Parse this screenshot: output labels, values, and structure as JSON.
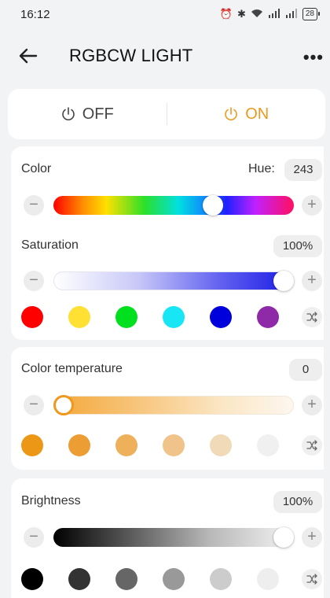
{
  "status_bar": {
    "time": "16:12",
    "battery": "28"
  },
  "header": {
    "title": "RGBCW LIGHT"
  },
  "power": {
    "off_label": "OFF",
    "on_label": "ON",
    "active": "on",
    "active_color": "#f0981e"
  },
  "color_section": {
    "label": "Color",
    "hue_label": "Hue:",
    "hue_value": "243",
    "hue_slider_fraction": 0.68,
    "saturation_label": "Saturation",
    "saturation_value": "100%",
    "saturation_slider_fraction": 1.0,
    "presets": [
      "#ff0000",
      "#ffe033",
      "#00e01e",
      "#19e6f5",
      "#0000dd",
      "#8e2aa8"
    ]
  },
  "temperature_section": {
    "label": "Color temperature",
    "value": "0",
    "slider_fraction": 0.0,
    "presets": [
      "#ec9716",
      "#ec9d33",
      "#eeb05a",
      "#efc38a",
      "#f0dab8",
      "#f0f0f0"
    ]
  },
  "brightness_section": {
    "label": "Brightness",
    "value": "100%",
    "slider_fraction": 1.0,
    "presets": [
      "#000000",
      "#333333",
      "#666666",
      "#999999",
      "#cccccc",
      "#eeeeee"
    ]
  },
  "icons": {
    "back": "arrow-left",
    "more": "ellipsis",
    "power": "power",
    "minus": "minus",
    "plus": "plus",
    "shuffle": "shuffle"
  }
}
